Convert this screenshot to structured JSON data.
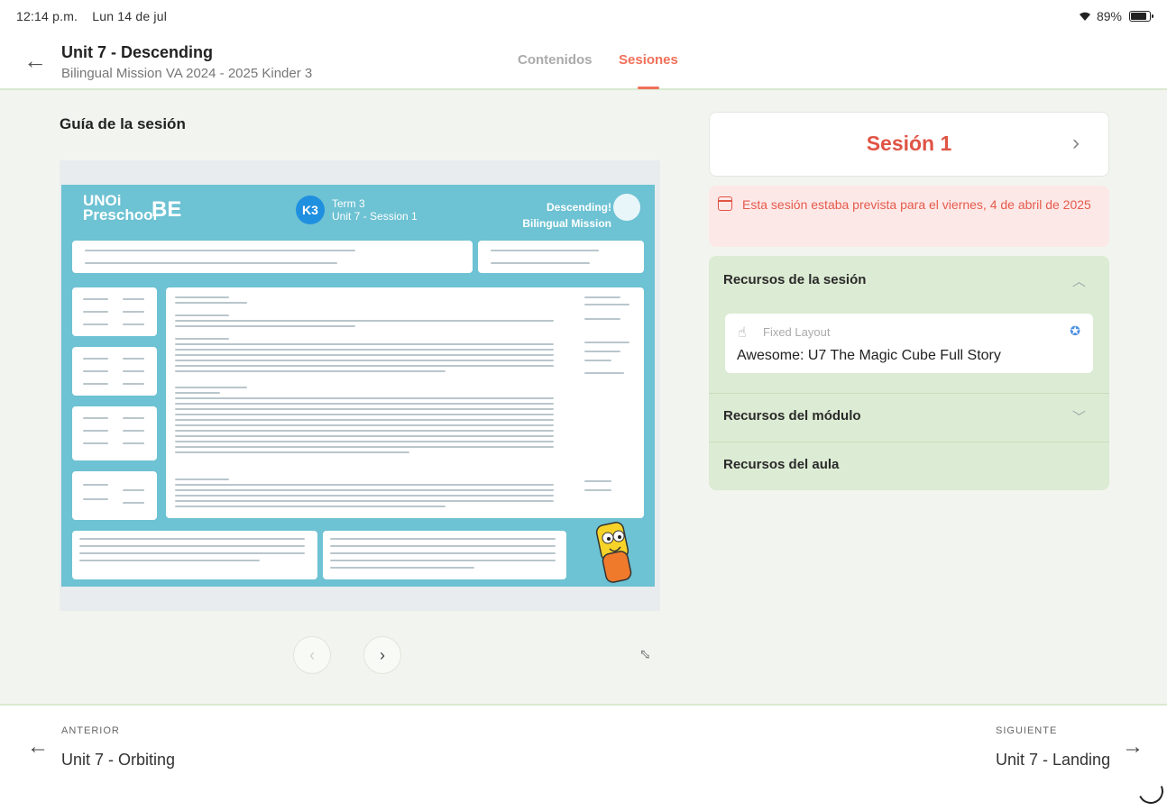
{
  "status_bar": {
    "time": "12:14 p.m.",
    "date": "Lun 14 de jul",
    "battery": "89%",
    "battery_level": 0.89
  },
  "header": {
    "title": "Unit 7 - Descending",
    "subtitle": "Bilingual Mission VA 2024 - 2025 Kinder 3",
    "tabs": [
      {
        "label": "Contenidos",
        "active": false
      },
      {
        "label": "Sesiones",
        "active": true
      }
    ]
  },
  "guide": {
    "title": "Guía de la sesión",
    "doc": {
      "logo1": "UNOi Preschool",
      "logo2": "BE",
      "badge": "K3",
      "term": "Term 3",
      "session": "Unit 7 - Session 1",
      "brand_line1": "Descending!",
      "brand_line2": "Bilingual Mission"
    }
  },
  "pager": {
    "prev": "‹",
    "next": "›"
  },
  "session": {
    "title": "Sesión 1"
  },
  "alert": {
    "text": "Esta sesión estaba prevista para el ",
    "date": "viernes, 4 de abril de 2025"
  },
  "resources": {
    "session_title": "Recursos de la sesión",
    "item": {
      "type": "Fixed Layout",
      "title": "Awesome: U7 The Magic Cube Full Story"
    },
    "module_title": "Recursos del módulo",
    "classroom_title": "Recursos del aula"
  },
  "footer": {
    "prev_label": "ANTERIOR",
    "prev_title": "Unit 7 - Orbiting",
    "next_label": "SIGUIENTE",
    "next_title": "Unit 7 - Landing"
  },
  "colors": {
    "accent": "#f0705a",
    "session_red": "#e05446",
    "alert_bg": "#fde8e8",
    "panel_green": "#dcebd3",
    "doc_blue": "#6dc2d3"
  }
}
